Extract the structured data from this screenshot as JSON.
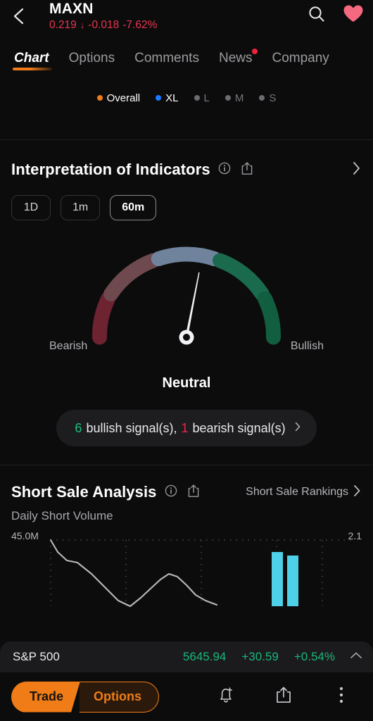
{
  "header": {
    "back_icon": "chevron-left-icon",
    "symbol": "MAXN",
    "price": "0.219",
    "direction_arrow": "↓",
    "change": "-0.018",
    "change_pct": "-7.62%",
    "negative_color": "#e8364f",
    "search_icon": "search-icon",
    "favorite_icon": "heart-icon",
    "favorite_color": "#f4697f"
  },
  "tabs": [
    {
      "label": "Chart",
      "active": true,
      "badge": false
    },
    {
      "label": "Options",
      "active": false,
      "badge": false
    },
    {
      "label": "Comments",
      "active": false,
      "badge": false
    },
    {
      "label": "News",
      "active": false,
      "badge": true
    },
    {
      "label": "Company",
      "active": false,
      "badge": false
    }
  ],
  "legend": [
    {
      "label": "Overall",
      "color": "#f07c18",
      "active": true
    },
    {
      "label": "XL",
      "color": "#1a7cff",
      "active": true
    },
    {
      "label": "L",
      "color": "#6b6b70",
      "active": false
    },
    {
      "label": "M",
      "color": "#6b6b70",
      "active": false
    },
    {
      "label": "S",
      "color": "#6b6b70",
      "active": false
    }
  ],
  "indicators": {
    "title": "Interpretation of Indicators",
    "info_icon": "info-icon",
    "share_icon": "share-icon",
    "chevron_icon": "chevron-right-icon",
    "periods": [
      {
        "label": "1D",
        "selected": false
      },
      {
        "label": "1m",
        "selected": false
      },
      {
        "label": "60m",
        "selected": true
      }
    ],
    "gauge": {
      "left_label": "Bearish",
      "right_label": "Bullish",
      "verdict": "Neutral",
      "needle_angle_deg": 11,
      "segments": [
        {
          "name": "strong-bearish",
          "color": "#6e2331"
        },
        {
          "name": "bearish",
          "color": "#6e4a4f"
        },
        {
          "name": "neutral",
          "color": "#6f839c"
        },
        {
          "name": "bullish",
          "color": "#1a6b4e"
        },
        {
          "name": "strong-bullish",
          "color": "#125e41"
        }
      ]
    },
    "signals": {
      "bullish_count": "6",
      "bullish_text": "bullish signal(s),",
      "bearish_count": "1",
      "bearish_text": "bearish signal(s)",
      "bullish_color": "#16c07c",
      "bearish_color": "#f0234a",
      "chevron_icon": "chevron-right-icon"
    }
  },
  "short_sale": {
    "title": "Short Sale Analysis",
    "info_icon": "info-icon",
    "share_icon": "share-icon",
    "rankings_label": "Short Sale Rankings",
    "rankings_chevron": "chevron-right-icon",
    "sub_label": "Daily Short Volume",
    "axis_left_top": "45.0M",
    "axis_right_top": "2.1",
    "line_color": "#b9b9bd",
    "bar_color": "#4dd0e8"
  },
  "index_bar": {
    "name": "S&P 500",
    "value": "5645.94",
    "change": "+30.59",
    "change_pct": "+0.54%",
    "positive_color": "#19b87a",
    "chevron_icon": "chevron-up-icon"
  },
  "bottom_bar": {
    "trade_label": "Trade",
    "options_label": "Options",
    "accent_color": "#ef7c17",
    "alert_icon": "bell-plus-icon",
    "share_icon": "share-icon",
    "more_icon": "more-vertical-icon"
  }
}
